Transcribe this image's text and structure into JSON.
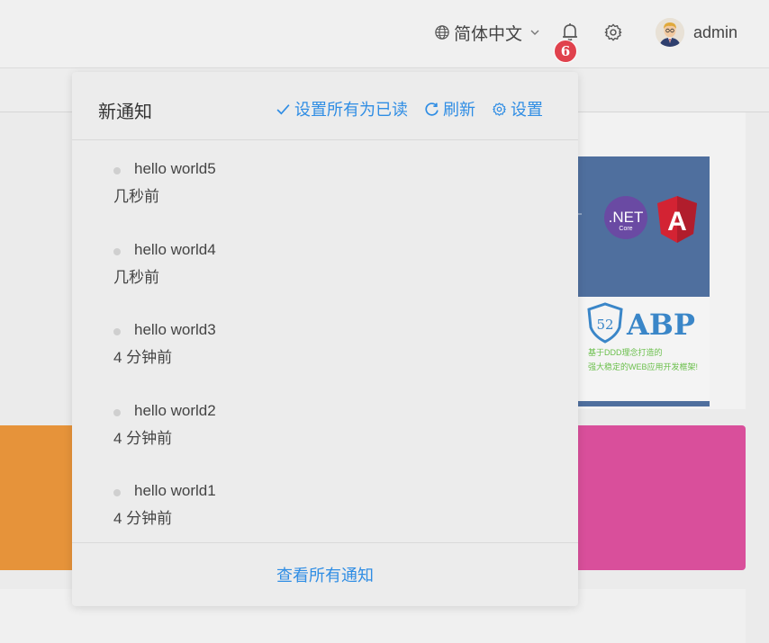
{
  "header": {
    "language": "简体中文",
    "notification_count": "6",
    "username": "admin"
  },
  "notifications": {
    "title": "新通知",
    "actions": {
      "mark_all_read": "设置所有为已读",
      "refresh": "刷新",
      "settings": "设置"
    },
    "items": [
      {
        "title": "hello world5",
        "time": "几秒前"
      },
      {
        "title": "hello world4",
        "time": "几秒前"
      },
      {
        "title": "hello world3",
        "time": "4 分钟前"
      },
      {
        "title": "hello world2",
        "time": "4 分钟前"
      },
      {
        "title": "hello world1",
        "time": "4 分钟前"
      }
    ],
    "view_all": "查看所有通知"
  },
  "banner": {
    "net_core": ".NET",
    "core_sub": "Core",
    "angular_letter": "A",
    "abp_number": "52",
    "abp_text": "ABP",
    "tagline_1": "基于DDD理念打造的",
    "tagline_2": "强大稳定的WEB应用开发框架!"
  },
  "colors": {
    "accent": "#2f8de4",
    "badge": "#e0424d",
    "orange": "#e6933a",
    "pink": "#d94f9b",
    "banner_blue": "#4f6f9e"
  },
  "icons": [
    "globe-icon",
    "chevron-down-icon",
    "bell-icon",
    "gear-icon",
    "check-icon",
    "refresh-icon"
  ]
}
